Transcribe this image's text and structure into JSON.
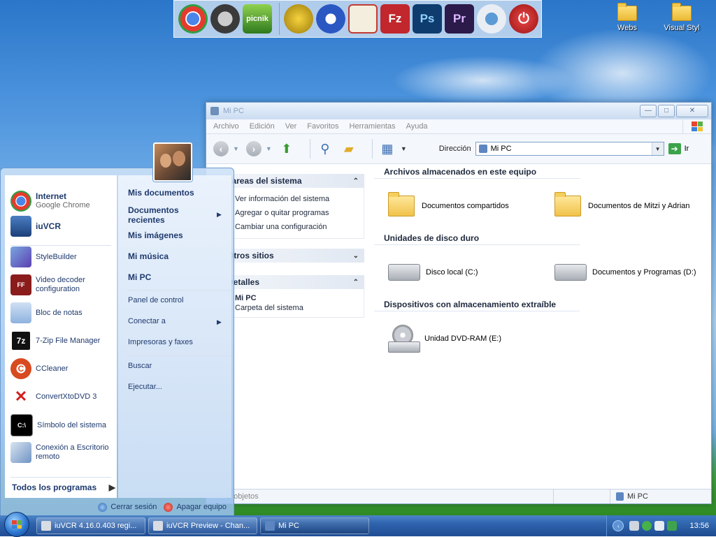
{
  "desktop": {
    "icons": [
      {
        "label": "Webs"
      },
      {
        "label": "Visual Styl"
      }
    ],
    "dock": [
      {
        "icon": "chrome-icon",
        "color": "#e53b2f"
      },
      {
        "icon": "grooveshark-icon",
        "color": "#3a3a3a"
      },
      {
        "icon": "picnik-icon",
        "color": "#4e9a2b",
        "text": "picnik"
      },
      {
        "icon": "media-icon",
        "color": "#d6a816"
      },
      {
        "icon": "play-icon",
        "color": "#2a57c2"
      },
      {
        "icon": "notepad-icon",
        "color": "#d9d4c4"
      },
      {
        "icon": "filezilla-icon",
        "color": "#c1272d"
      },
      {
        "icon": "photoshop-icon",
        "color": "#0f3c6e",
        "text": "Ps"
      },
      {
        "icon": "premiere-icon",
        "color": "#2b1a4a",
        "text": "Pr"
      },
      {
        "icon": "network-icon",
        "color": "#cfd9e6"
      },
      {
        "icon": "power-icon",
        "color": "#c62020"
      }
    ]
  },
  "explorer": {
    "title": "Mi PC",
    "menu": [
      "Archivo",
      "Edición",
      "Ver",
      "Favoritos",
      "Herramientas",
      "Ayuda"
    ],
    "address_label": "Dirección",
    "address_value": "Mi PC",
    "go_label": "Ir",
    "tasks": {
      "system_title": "Tareas del sistema",
      "system_items": [
        "Ver información del sistema",
        "Agregar o quitar programas",
        "Cambiar una configuración"
      ],
      "other_title": "Otros sitios",
      "details_title": "Detalles",
      "details_name": "Mi PC",
      "details_desc": "Carpeta del sistema"
    },
    "groups": {
      "stored_title": "Archivos almacenados en este equipo",
      "stored": [
        "Documentos compartidos",
        "Documentos de Mitzi y Adrian"
      ],
      "disks_title": "Unidades de disco duro",
      "disks": [
        "Disco local (C:)",
        "Documentos y Programas (D:)"
      ],
      "removable_title": "Dispositivos con almacenamiento extraíble",
      "removable": [
        "Unidad DVD-RAM (E:)"
      ]
    },
    "status": {
      "objects": "5 objetos",
      "location": "Mi PC"
    }
  },
  "start_menu": {
    "pinned": [
      {
        "name": "Internet",
        "sub": "Google Chrome"
      },
      {
        "name": "iuVCR",
        "sub": ""
      }
    ],
    "recent": [
      "StyleBuilder",
      "Video decoder configuration",
      "Bloc de notas",
      "7-Zip File Manager",
      "CCleaner",
      "ConvertXtoDVD 3",
      "Símbolo del sistema",
      "Conexión a Escritorio remoto"
    ],
    "all_programs": "Todos los programas",
    "right": {
      "my_documents": "Mis documentos",
      "recent_documents": "Documentos recientes",
      "my_pictures": "Mis imágenes",
      "my_music": "Mi música",
      "my_pc": "Mi PC",
      "control_panel": "Panel de control",
      "connect_to": "Conectar a",
      "printers": "Impresoras y faxes",
      "search": "Buscar",
      "run": "Ejecutar..."
    },
    "logoff": "Cerrar sesión",
    "shutdown": "Apagar equipo"
  },
  "taskbar": {
    "tasks": [
      "iuVCR 4.16.0.403 regi...",
      "iuVCR Preview - Chan...",
      "Mi PC"
    ],
    "clock": "13:56"
  }
}
